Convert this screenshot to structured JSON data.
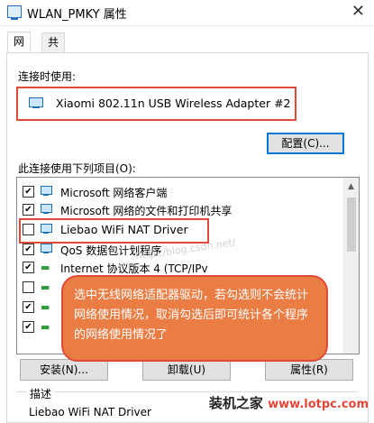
{
  "window": {
    "title": "WLAN_PMKY 属性",
    "close_glyph": "✕"
  },
  "tabs": [
    {
      "label": "网络",
      "active": true
    },
    {
      "label": "共享",
      "active": false
    }
  ],
  "connect_using": {
    "label": "连接时使用:",
    "adapter": "Xiaomi 802.11n USB Wireless Adapter #2",
    "configure_button": "配置(C)..."
  },
  "items_label": "此连接使用下列项目(O):",
  "items": [
    {
      "label": "Microsoft 网络客户端",
      "checked": true
    },
    {
      "label": "Microsoft 网络的文件和打印机共享",
      "checked": true
    },
    {
      "label": "Liebao WiFi NAT Driver",
      "checked": false
    },
    {
      "label": "QoS 数据包计划程序",
      "checked": true
    },
    {
      "label": "Internet 协议版本 4 (TCP/IPv",
      "checked": true
    },
    {
      "label": "",
      "checked": false
    },
    {
      "label": "",
      "checked": true
    },
    {
      "label": "",
      "checked": true
    }
  ],
  "buttons": {
    "install": "安装(N)...",
    "uninstall": "卸载(U)",
    "properties": "属性(R)"
  },
  "description": {
    "label": "描述",
    "text": "Liebao WiFi NAT Driver"
  },
  "callout": {
    "text": "选中无线网络适配器驱动，若勾选则不会统计网络使用情况，取消勾选后即可统计各个程序的网络使用情况了"
  },
  "watermark": "http://blog.csdn.net/",
  "branding": {
    "name": "装机之家",
    "url": "www.lotpc.com"
  },
  "colors": {
    "highlight_border": "#e0483a",
    "callout_fill": "#ea7d44",
    "focus_blue": "#0078d7"
  }
}
